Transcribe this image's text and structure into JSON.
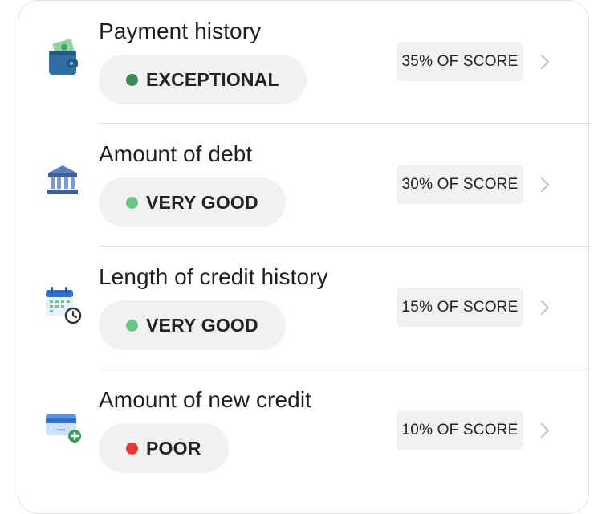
{
  "factors": [
    {
      "title": "Payment history",
      "status": "EXCEPTIONAL",
      "status_color": "#3d8b57",
      "weight": "35% OF SCORE",
      "icon": "wallet-icon"
    },
    {
      "title": "Amount of debt",
      "status": "VERY GOOD",
      "status_color": "#6cc58a",
      "weight": "30% OF SCORE",
      "icon": "bank-icon"
    },
    {
      "title": "Length of credit history",
      "status": "VERY GOOD",
      "status_color": "#6cc58a",
      "weight": "15% OF SCORE",
      "icon": "calendar-clock-icon"
    },
    {
      "title": "Amount of new credit",
      "status": "POOR",
      "status_color": "#e53935",
      "weight": "10% OF SCORE",
      "icon": "credit-card-add-icon"
    }
  ],
  "colors": {
    "pill_background": "#f1f1f1",
    "divider": "#e0e0e0",
    "chevron": "#c4c4c4"
  }
}
